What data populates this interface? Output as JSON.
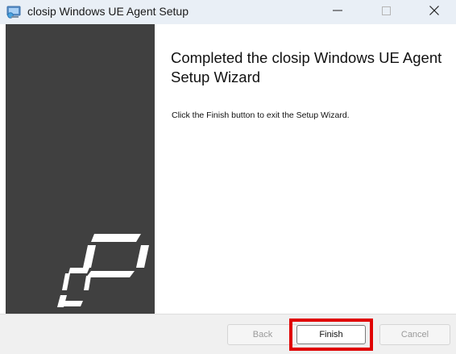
{
  "window": {
    "title": "closip Windows UE Agent Setup",
    "app_icon": "installer-icon",
    "controls": [
      "minimize-icon",
      "maximize-icon",
      "close-icon"
    ]
  },
  "banner": {
    "logo": "closip-logo",
    "background_color": "#404040"
  },
  "content": {
    "heading": "Completed the closip Windows UE Agent Setup Wizard",
    "body": "Click the Finish button to exit the Setup Wizard."
  },
  "buttons": {
    "back_label": "Back",
    "finish_label": "Finish",
    "cancel_label": "Cancel"
  },
  "annotation": {
    "highlight_color": "#e00000"
  }
}
